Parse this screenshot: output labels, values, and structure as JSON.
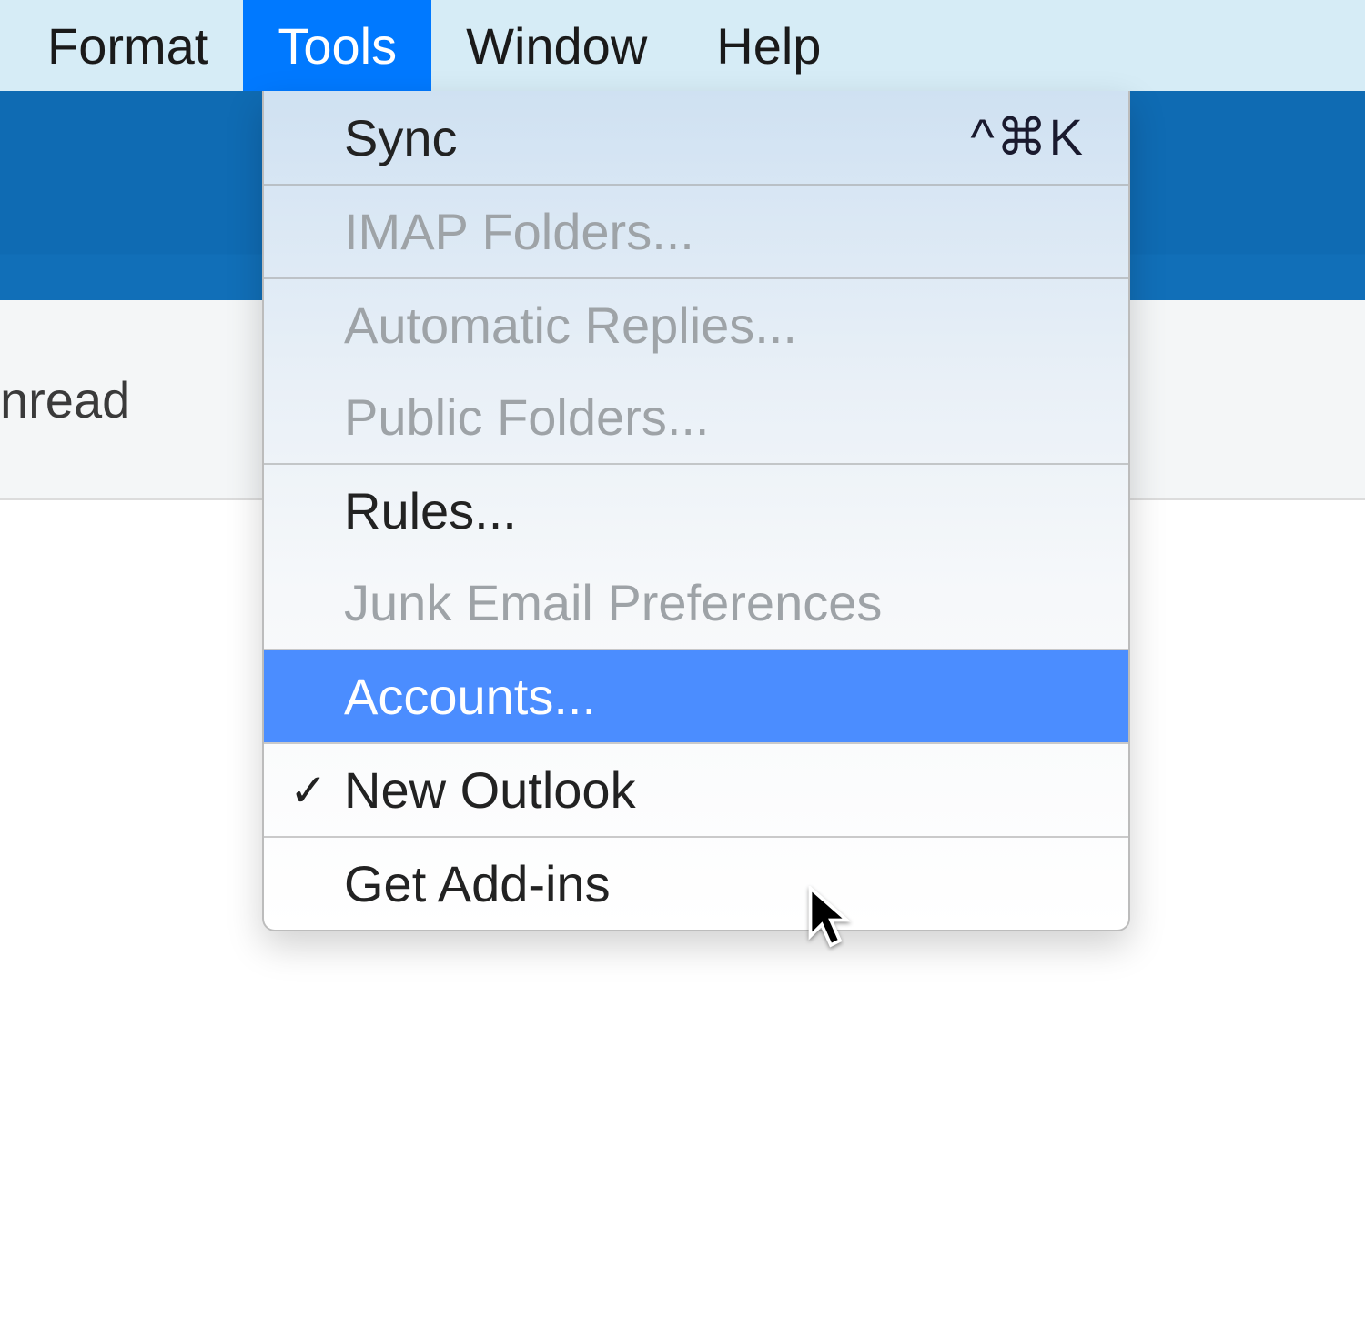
{
  "menubar": {
    "items": [
      {
        "label": "Format",
        "active": false
      },
      {
        "label": "Tools",
        "active": true
      },
      {
        "label": "Window",
        "active": false
      },
      {
        "label": "Help",
        "active": false
      }
    ]
  },
  "background": {
    "tab_label": "nread"
  },
  "dropdown": {
    "groups": [
      {
        "items": [
          {
            "label": "Sync",
            "shortcut": "^⌘K",
            "enabled": true,
            "highlighted": false,
            "checked": false
          }
        ]
      },
      {
        "items": [
          {
            "label": "IMAP Folders...",
            "shortcut": "",
            "enabled": false,
            "highlighted": false,
            "checked": false
          }
        ]
      },
      {
        "items": [
          {
            "label": "Automatic Replies...",
            "shortcut": "",
            "enabled": false,
            "highlighted": false,
            "checked": false
          },
          {
            "label": "Public Folders...",
            "shortcut": "",
            "enabled": false,
            "highlighted": false,
            "checked": false
          }
        ]
      },
      {
        "items": [
          {
            "label": "Rules...",
            "shortcut": "",
            "enabled": true,
            "highlighted": false,
            "checked": false
          },
          {
            "label": "Junk Email Preferences",
            "shortcut": "",
            "enabled": false,
            "highlighted": false,
            "checked": false
          }
        ]
      },
      {
        "items": [
          {
            "label": "Accounts...",
            "shortcut": "",
            "enabled": true,
            "highlighted": true,
            "checked": false
          }
        ]
      },
      {
        "items": [
          {
            "label": "New Outlook",
            "shortcut": "",
            "enabled": true,
            "highlighted": false,
            "checked": true
          }
        ]
      },
      {
        "items": [
          {
            "label": "Get Add-ins",
            "shortcut": "",
            "enabled": true,
            "highlighted": false,
            "checked": false
          }
        ]
      }
    ]
  }
}
